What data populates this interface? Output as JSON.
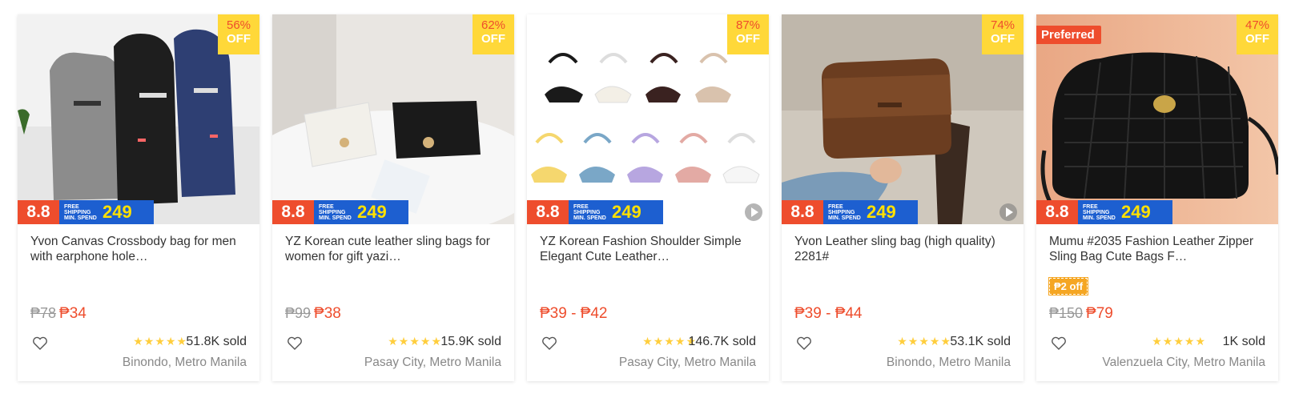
{
  "colors": {
    "accent": "#ee4d2d",
    "discount_bg": "#ffd839",
    "shipping_bg": "#1d5fd0",
    "star": "#ffce3d"
  },
  "promo": {
    "event": "8.8",
    "shipping_line1": "FREE",
    "shipping_line2": "SHIPPING",
    "shipping_line3": "MIN. SPEND",
    "shipping_amount": "249"
  },
  "products": [
    {
      "title": "Yvon Canvas Crossbody bag for men with earphone hole…",
      "discount_pct": "56%",
      "discount_off": "OFF",
      "orig_price": "₱78",
      "price": "₱34",
      "stars": "★★★★★",
      "sold": "51.8K sold",
      "location": "Binondo, Metro Manila",
      "image_icon": "crossbody-bags-image",
      "rating": 5
    },
    {
      "title": "YZ Korean cute leather sling bags for women for gift yazi…",
      "discount_pct": "62%",
      "discount_off": "OFF",
      "orig_price": "₱99",
      "price": "₱38",
      "stars": "★★★★★",
      "sold": "15.9K sold",
      "location": "Pasay City, Metro Manila",
      "image_icon": "sling-bags-image",
      "rating": 5
    },
    {
      "title": "YZ Korean Fashion Shoulder Simple Elegant Cute Leather…",
      "discount_pct": "87%",
      "discount_off": "OFF",
      "orig_price": "",
      "price": "₱39 - ₱42",
      "stars": "★★★★★",
      "sold": "146.7K sold",
      "location": "Pasay City, Metro Manila",
      "image_icon": "shoulder-bags-image",
      "rating": 5
    },
    {
      "title": "Yvon Leather sling bag (high quality) 2281#",
      "discount_pct": "74%",
      "discount_off": "OFF",
      "orig_price": "",
      "price": "₱39 - ₱44",
      "stars": "★★★★★",
      "sold": "53.1K sold",
      "location": "Binondo, Metro Manila",
      "image_icon": "leather-sling-bag-image",
      "rating": 5
    },
    {
      "title": "Mumu #2035 Fashion Leather Zipper Sling Bag Cute Bags F…",
      "discount_pct": "47%",
      "discount_off": "OFF",
      "preferred": "Preferred",
      "coupon": "₱2 off",
      "orig_price": "₱150",
      "price": "₱79",
      "stars": "★★★★★",
      "sold": "1K sold",
      "location": "Valenzuela City, Metro Manila",
      "image_icon": "quilted-sling-bag-image",
      "rating": 5
    }
  ]
}
